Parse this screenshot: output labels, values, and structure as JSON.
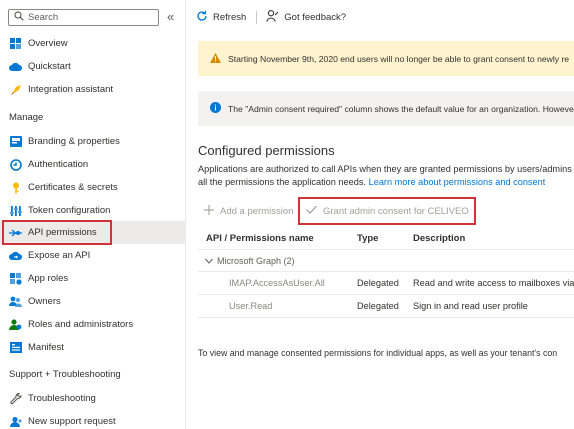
{
  "sidebar": {
    "search_placeholder": "Search",
    "collapse_glyph": "«",
    "top_items": [
      {
        "label": "Overview",
        "icon": "grid-icon"
      },
      {
        "label": "Quickstart",
        "icon": "cloud-icon"
      },
      {
        "label": "Integration assistant",
        "icon": "rocket-icon"
      }
    ],
    "manage_title": "Manage",
    "manage_items": [
      {
        "label": "Branding & properties",
        "icon": "branding-icon"
      },
      {
        "label": "Authentication",
        "icon": "authentication-icon"
      },
      {
        "label": "Certificates & secrets",
        "icon": "key-icon"
      },
      {
        "label": "Token configuration",
        "icon": "token-icon"
      },
      {
        "label": "API permissions",
        "icon": "api-permissions-icon",
        "active": true
      },
      {
        "label": "Expose an API",
        "icon": "expose-api-icon"
      },
      {
        "label": "App roles",
        "icon": "app-roles-icon"
      },
      {
        "label": "Owners",
        "icon": "owners-icon"
      },
      {
        "label": "Roles and administrators",
        "icon": "roles-icon"
      },
      {
        "label": "Manifest",
        "icon": "manifest-icon"
      }
    ],
    "support_title": "Support + Troubleshooting",
    "support_items": [
      {
        "label": "Troubleshooting",
        "icon": "wrench-icon"
      },
      {
        "label": "New support request",
        "icon": "support-icon"
      }
    ]
  },
  "toolbar": {
    "refresh_label": "Refresh",
    "feedback_label": "Got feedback?"
  },
  "banners": {
    "warning_text": "Starting November 9th, 2020 end users will no longer be able to grant consent to newly re",
    "info_text": "The \"Admin consent required\" column shows the default value for an organization. However"
  },
  "content": {
    "heading": "Configured permissions",
    "desc_line1": "Applications are authorized to call APIs when they are granted permissions by users/admins",
    "desc_line2": "all the permissions the application needs.",
    "desc_link": "Learn more about permissions and consent",
    "add_permission": "Add a permission",
    "grant_consent": "Grant admin consent for CELIVEO",
    "footer_note": "To view and manage consented permissions for individual apps, as well as your tenant's con"
  },
  "table": {
    "headers": {
      "name": "API / Permissions name",
      "type": "Type",
      "description": "Description"
    },
    "group": "Microsoft Graph (2)",
    "rows": [
      {
        "name": "IMAP.AccessAsUser.All",
        "type": "Delegated",
        "description": "Read and write access to mailboxes via"
      },
      {
        "name": "User.Read",
        "type": "Delegated",
        "description": "Sign in and read user profile"
      }
    ]
  },
  "colors": {
    "accent": "#0078d4",
    "highlight_border": "#d13438",
    "warning_bg": "#fff4ce",
    "info_bg": "#f3f2f1"
  }
}
